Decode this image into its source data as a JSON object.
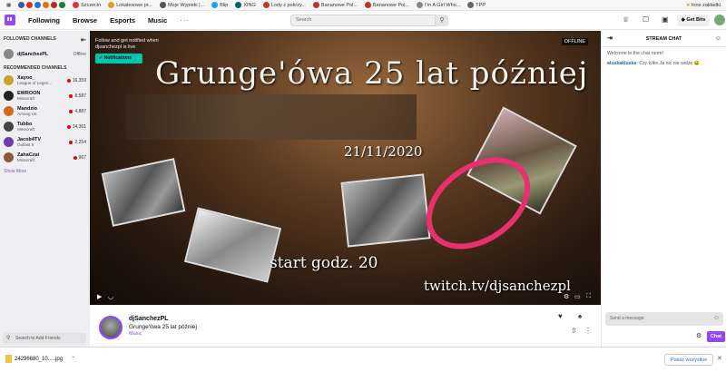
{
  "bookmarks": [
    {
      "label": "Szczecin",
      "color": "#d33"
    },
    {
      "label": "Lokalesowe pr...",
      "color": "#e39b2a"
    },
    {
      "label": "Moje Wypieki |...",
      "color": "#555"
    },
    {
      "label": "Blip",
      "color": "#1da1f2"
    },
    {
      "label": "XING",
      "color": "#026466"
    },
    {
      "label": "Lody z pokrzy...",
      "color": "#c0392b"
    },
    {
      "label": "Bananowe Pol...",
      "color": "#b33"
    },
    {
      "label": "Bananowe Pol...",
      "color": "#b33"
    },
    {
      "label": "I'm A Girl Who...",
      "color": "#888"
    },
    {
      "label": "TPP",
      "color": "#666"
    }
  ],
  "bookmarks_other": "Inne zakładki",
  "nav": {
    "following": "Following",
    "browse": "Browse",
    "esports": "Esports",
    "music": "Music",
    "more": "···",
    "search_placeholder": "Search",
    "get_bits": "Get Bits"
  },
  "sidebar": {
    "followed_header": "FOLLOWED CHANNELS",
    "followed": [
      {
        "name": "djSanchezPL",
        "status": "Offline",
        "color": "#888"
      }
    ],
    "recommended_header": "RECOMMENDED CHANNELS",
    "recommended": [
      {
        "name": "Xayoo_",
        "game": "League of Legen...",
        "viewers": "16,359",
        "color": "#c9a227"
      },
      {
        "name": "EWROON",
        "game": "Minecraft",
        "viewers": "8,587",
        "color": "#222"
      },
      {
        "name": "Mandzio",
        "game": "Among Us",
        "viewers": "4,887",
        "color": "#d2691e"
      },
      {
        "name": "Tubbo",
        "game": "Minecraft",
        "viewers": "34,361",
        "color": "#444"
      },
      {
        "name": "Jacob4TV",
        "game": "Outlast II",
        "viewers": "2,254",
        "color": "#6a3fb5"
      },
      {
        "name": "ZahaCzai",
        "game": "Minecraft",
        "viewers": "967",
        "color": "#8b5a3c"
      }
    ],
    "show_more": "Show More",
    "search_friends": "Search to Add Friends"
  },
  "video": {
    "notify_text": "Follow and get notified when djsanchezpl is live",
    "notifications_button": "Notifications",
    "offline_label": "OFFLINE",
    "poster_title": "Grunge'ówa 25 lat później",
    "poster_date": "21/11/2020",
    "poster_start": "start godz. 20",
    "poster_url": "twitch.tv/djsanchezpl",
    "circle_color": "#e8306e"
  },
  "stream": {
    "channel": "djSanchezPL",
    "title": "Grunge'ówa 25 lat później",
    "category": "Music"
  },
  "chat": {
    "header": "STREAM CHAT",
    "welcome": "Welcome to the chat room!",
    "messages": [
      {
        "user": "aluskakluska",
        "text": ": Czy tylko Ja nic nie widzę 😀"
      }
    ],
    "input_placeholder": "Send a message",
    "chat_button": "Chat"
  },
  "downloads": {
    "file": "24296680_10.....jpg",
    "show_all": "Pokaż wszystkie"
  },
  "colors": {
    "brand": "#9146ff",
    "live_dot": "#eb0400",
    "notify_button": "#00c7ac"
  }
}
